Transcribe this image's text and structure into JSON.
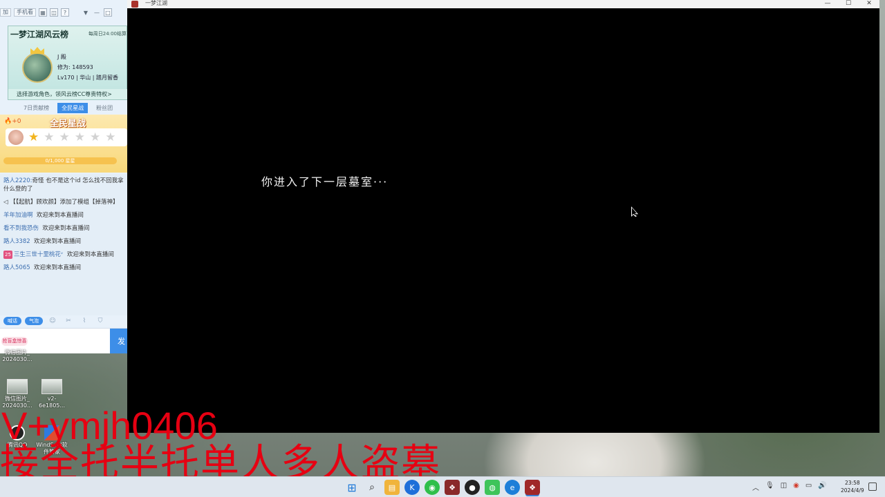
{
  "live_panel": {
    "topbar": {
      "chip_left": "加",
      "chip_phone": "手机看",
      "icons": [
        "grid-icon",
        "image-icon",
        "help-icon",
        "dropdown-icon",
        "minimize-icon",
        "maximize-icon"
      ]
    },
    "banner": {
      "title": "一梦江湖风云榜",
      "time_note": "每周日24:00结算",
      "user_name": "J 殿",
      "cultivation": "修为: 148593",
      "level_line": "Lv170 | 华山 | 踏月留香",
      "cta": "选择游戏角色，领风云榜CC尊贵特权>"
    },
    "tabs": [
      {
        "label": "7日贡献榜",
        "active": false
      },
      {
        "label": "全民星战",
        "active": true
      },
      {
        "label": "粉丝团",
        "active": false
      }
    ],
    "event": {
      "flame_count": "+0",
      "title": "全民星战",
      "stars_lit": 1,
      "stars_total": 6,
      "progress_text": "0/1,000 星星"
    },
    "chat": [
      {
        "who": "路人2220:",
        "text": "奇怪 也不是这个id 怎么找不回我拿什么登的了",
        "wrap": true
      },
      {
        "who": "",
        "text": "◁ 【【起航】顾欢颜】添加了模组【掉落神】",
        "wrap": true
      },
      {
        "who": "羊年加油啊",
        "text": "欢迎来到本直播间"
      },
      {
        "who": "看不到我恐伤",
        "text": "欢迎来到本直播间"
      },
      {
        "who": "路人3382",
        "text": "欢迎来到本直播间"
      },
      {
        "who": "三生三世十里桃花ᵛ",
        "tag": "25",
        "text": "欢迎来到本直播间",
        "wrap": true
      },
      {
        "who": "路人5065",
        "text": "欢迎来到本直播间"
      }
    ],
    "toolbar": {
      "pill_1": "喊话",
      "pill_2": "气泡"
    },
    "gift_label": "抢盲盒惊喜",
    "send_label": "发"
  },
  "desktop_icons": [
    {
      "label_1": "微信图片_",
      "label_2": "2024030..."
    },
    {
      "label_1": "微信图片_",
      "label_2": "2024030..."
    },
    {
      "label_1": "v2-6e1805...",
      "label_2": ""
    },
    {
      "label_1": "腾讯QQ",
      "label_2": ""
    },
    {
      "label_1": "WindSoul软",
      "label_2": "件管家"
    }
  ],
  "game_window": {
    "title": "一梦江湖",
    "message": "你进入了下一层墓室···",
    "controls": [
      "—",
      "☐",
      "✕"
    ]
  },
  "overlay": {
    "line_1": "V+ymjh0406",
    "line_2": "接全托半托单人多人盗墓",
    "color": "#e60012"
  },
  "taskbar": {
    "clock_time": "23:58",
    "clock_date": "2024/4/9",
    "apps": [
      "start-icon",
      "search-icon",
      "files-icon",
      "kugou-icon",
      "wechat-green-icon",
      "game-icon",
      "game-icon-2",
      "wechat-icon",
      "edge-icon",
      "game-active-icon"
    ]
  }
}
